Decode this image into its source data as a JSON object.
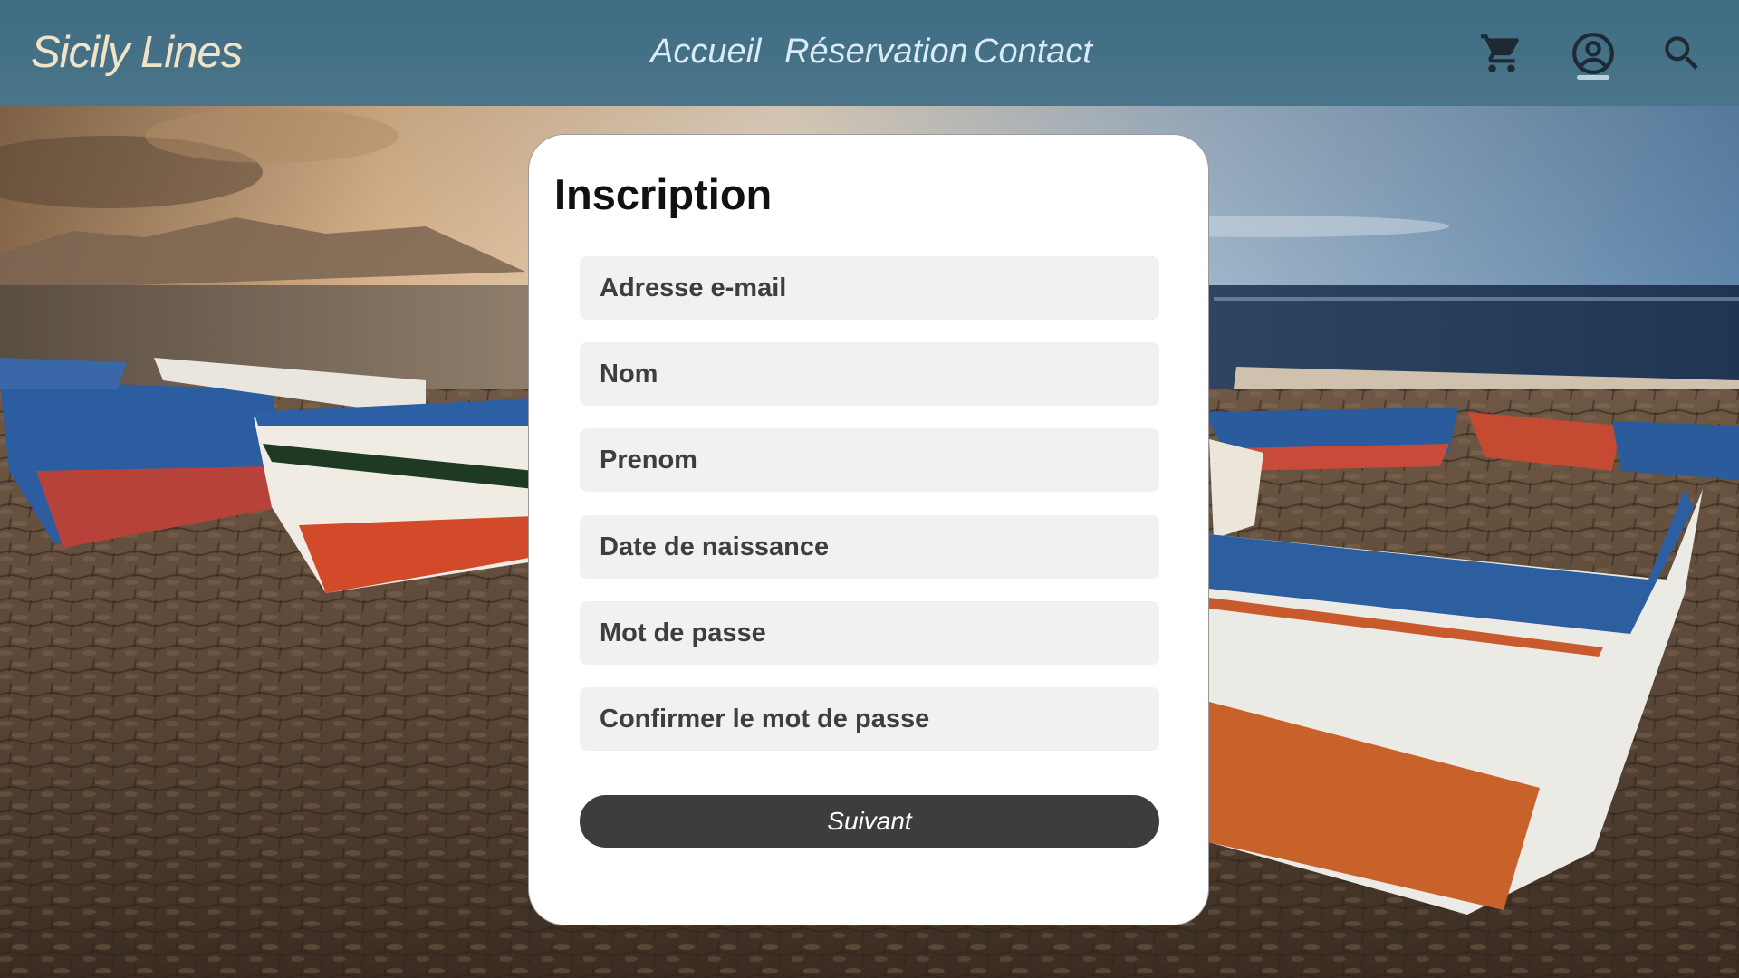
{
  "header": {
    "logo": "Sicily Lines",
    "nav": {
      "accueil": "Accueil",
      "reservation": "Réservation",
      "contact": "Contact"
    },
    "icons": {
      "cart": "shopping-cart-icon",
      "account": "account-circle-icon",
      "search": "search-icon"
    },
    "active_icon": "account"
  },
  "form": {
    "title": "Inscription",
    "fields": [
      {
        "placeholder": "Adresse e-mail",
        "value": ""
      },
      {
        "placeholder": "Nom",
        "value": ""
      },
      {
        "placeholder": "Prenom",
        "value": ""
      },
      {
        "placeholder": "Date de naissance",
        "value": ""
      },
      {
        "placeholder": "Mot de passe",
        "value": ""
      },
      {
        "placeholder": "Confirmer le mot de passe",
        "value": ""
      }
    ],
    "submit_label": "Suivant"
  },
  "colors": {
    "header_bg": "#447189",
    "logo": "#f1e3c6",
    "nav_text": "#d9ebf4",
    "card_bg": "#ffffff",
    "field_bg": "#f1f1f1",
    "button_bg": "#3d3d3d",
    "button_text": "#ffffff"
  }
}
